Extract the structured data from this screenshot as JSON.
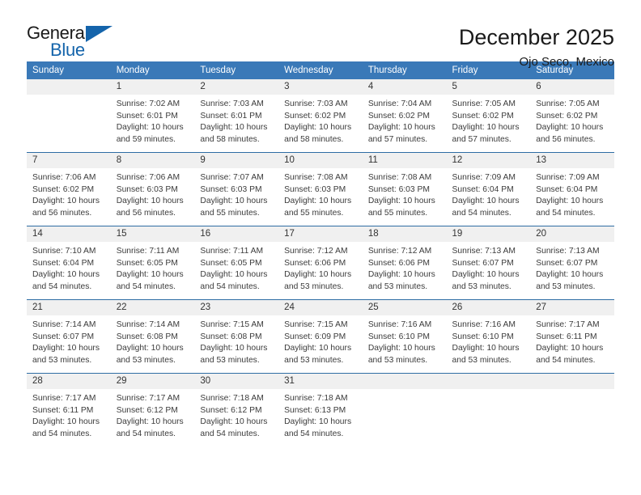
{
  "brand": {
    "line1": "General",
    "line2": "Blue",
    "triangle_color": "#1464ab"
  },
  "header": {
    "title": "December 2025",
    "subtitle": "Ojo Seco, Mexico",
    "header_bg": "#3a79b8",
    "daynum_bg": "#f0f0f0"
  },
  "weekdays": [
    "Sunday",
    "Monday",
    "Tuesday",
    "Wednesday",
    "Thursday",
    "Friday",
    "Saturday"
  ],
  "weeks": [
    [
      {
        "day": "",
        "sunrise": "",
        "sunset": "",
        "daylight_line1": "",
        "daylight_line2": ""
      },
      {
        "day": "1",
        "sunrise": "Sunrise: 7:02 AM",
        "sunset": "Sunset: 6:01 PM",
        "daylight_line1": "Daylight: 10 hours",
        "daylight_line2": "and 59 minutes."
      },
      {
        "day": "2",
        "sunrise": "Sunrise: 7:03 AM",
        "sunset": "Sunset: 6:01 PM",
        "daylight_line1": "Daylight: 10 hours",
        "daylight_line2": "and 58 minutes."
      },
      {
        "day": "3",
        "sunrise": "Sunrise: 7:03 AM",
        "sunset": "Sunset: 6:02 PM",
        "daylight_line1": "Daylight: 10 hours",
        "daylight_line2": "and 58 minutes."
      },
      {
        "day": "4",
        "sunrise": "Sunrise: 7:04 AM",
        "sunset": "Sunset: 6:02 PM",
        "daylight_line1": "Daylight: 10 hours",
        "daylight_line2": "and 57 minutes."
      },
      {
        "day": "5",
        "sunrise": "Sunrise: 7:05 AM",
        "sunset": "Sunset: 6:02 PM",
        "daylight_line1": "Daylight: 10 hours",
        "daylight_line2": "and 57 minutes."
      },
      {
        "day": "6",
        "sunrise": "Sunrise: 7:05 AM",
        "sunset": "Sunset: 6:02 PM",
        "daylight_line1": "Daylight: 10 hours",
        "daylight_line2": "and 56 minutes."
      }
    ],
    [
      {
        "day": "7",
        "sunrise": "Sunrise: 7:06 AM",
        "sunset": "Sunset: 6:02 PM",
        "daylight_line1": "Daylight: 10 hours",
        "daylight_line2": "and 56 minutes."
      },
      {
        "day": "8",
        "sunrise": "Sunrise: 7:06 AM",
        "sunset": "Sunset: 6:03 PM",
        "daylight_line1": "Daylight: 10 hours",
        "daylight_line2": "and 56 minutes."
      },
      {
        "day": "9",
        "sunrise": "Sunrise: 7:07 AM",
        "sunset": "Sunset: 6:03 PM",
        "daylight_line1": "Daylight: 10 hours",
        "daylight_line2": "and 55 minutes."
      },
      {
        "day": "10",
        "sunrise": "Sunrise: 7:08 AM",
        "sunset": "Sunset: 6:03 PM",
        "daylight_line1": "Daylight: 10 hours",
        "daylight_line2": "and 55 minutes."
      },
      {
        "day": "11",
        "sunrise": "Sunrise: 7:08 AM",
        "sunset": "Sunset: 6:03 PM",
        "daylight_line1": "Daylight: 10 hours",
        "daylight_line2": "and 55 minutes."
      },
      {
        "day": "12",
        "sunrise": "Sunrise: 7:09 AM",
        "sunset": "Sunset: 6:04 PM",
        "daylight_line1": "Daylight: 10 hours",
        "daylight_line2": "and 54 minutes."
      },
      {
        "day": "13",
        "sunrise": "Sunrise: 7:09 AM",
        "sunset": "Sunset: 6:04 PM",
        "daylight_line1": "Daylight: 10 hours",
        "daylight_line2": "and 54 minutes."
      }
    ],
    [
      {
        "day": "14",
        "sunrise": "Sunrise: 7:10 AM",
        "sunset": "Sunset: 6:04 PM",
        "daylight_line1": "Daylight: 10 hours",
        "daylight_line2": "and 54 minutes."
      },
      {
        "day": "15",
        "sunrise": "Sunrise: 7:11 AM",
        "sunset": "Sunset: 6:05 PM",
        "daylight_line1": "Daylight: 10 hours",
        "daylight_line2": "and 54 minutes."
      },
      {
        "day": "16",
        "sunrise": "Sunrise: 7:11 AM",
        "sunset": "Sunset: 6:05 PM",
        "daylight_line1": "Daylight: 10 hours",
        "daylight_line2": "and 54 minutes."
      },
      {
        "day": "17",
        "sunrise": "Sunrise: 7:12 AM",
        "sunset": "Sunset: 6:06 PM",
        "daylight_line1": "Daylight: 10 hours",
        "daylight_line2": "and 53 minutes."
      },
      {
        "day": "18",
        "sunrise": "Sunrise: 7:12 AM",
        "sunset": "Sunset: 6:06 PM",
        "daylight_line1": "Daylight: 10 hours",
        "daylight_line2": "and 53 minutes."
      },
      {
        "day": "19",
        "sunrise": "Sunrise: 7:13 AM",
        "sunset": "Sunset: 6:07 PM",
        "daylight_line1": "Daylight: 10 hours",
        "daylight_line2": "and 53 minutes."
      },
      {
        "day": "20",
        "sunrise": "Sunrise: 7:13 AM",
        "sunset": "Sunset: 6:07 PM",
        "daylight_line1": "Daylight: 10 hours",
        "daylight_line2": "and 53 minutes."
      }
    ],
    [
      {
        "day": "21",
        "sunrise": "Sunrise: 7:14 AM",
        "sunset": "Sunset: 6:07 PM",
        "daylight_line1": "Daylight: 10 hours",
        "daylight_line2": "and 53 minutes."
      },
      {
        "day": "22",
        "sunrise": "Sunrise: 7:14 AM",
        "sunset": "Sunset: 6:08 PM",
        "daylight_line1": "Daylight: 10 hours",
        "daylight_line2": "and 53 minutes."
      },
      {
        "day": "23",
        "sunrise": "Sunrise: 7:15 AM",
        "sunset": "Sunset: 6:08 PM",
        "daylight_line1": "Daylight: 10 hours",
        "daylight_line2": "and 53 minutes."
      },
      {
        "day": "24",
        "sunrise": "Sunrise: 7:15 AM",
        "sunset": "Sunset: 6:09 PM",
        "daylight_line1": "Daylight: 10 hours",
        "daylight_line2": "and 53 minutes."
      },
      {
        "day": "25",
        "sunrise": "Sunrise: 7:16 AM",
        "sunset": "Sunset: 6:10 PM",
        "daylight_line1": "Daylight: 10 hours",
        "daylight_line2": "and 53 minutes."
      },
      {
        "day": "26",
        "sunrise": "Sunrise: 7:16 AM",
        "sunset": "Sunset: 6:10 PM",
        "daylight_line1": "Daylight: 10 hours",
        "daylight_line2": "and 53 minutes."
      },
      {
        "day": "27",
        "sunrise": "Sunrise: 7:17 AM",
        "sunset": "Sunset: 6:11 PM",
        "daylight_line1": "Daylight: 10 hours",
        "daylight_line2": "and 54 minutes."
      }
    ],
    [
      {
        "day": "28",
        "sunrise": "Sunrise: 7:17 AM",
        "sunset": "Sunset: 6:11 PM",
        "daylight_line1": "Daylight: 10 hours",
        "daylight_line2": "and 54 minutes."
      },
      {
        "day": "29",
        "sunrise": "Sunrise: 7:17 AM",
        "sunset": "Sunset: 6:12 PM",
        "daylight_line1": "Daylight: 10 hours",
        "daylight_line2": "and 54 minutes."
      },
      {
        "day": "30",
        "sunrise": "Sunrise: 7:18 AM",
        "sunset": "Sunset: 6:12 PM",
        "daylight_line1": "Daylight: 10 hours",
        "daylight_line2": "and 54 minutes."
      },
      {
        "day": "31",
        "sunrise": "Sunrise: 7:18 AM",
        "sunset": "Sunset: 6:13 PM",
        "daylight_line1": "Daylight: 10 hours",
        "daylight_line2": "and 54 minutes."
      },
      {
        "day": "",
        "sunrise": "",
        "sunset": "",
        "daylight_line1": "",
        "daylight_line2": ""
      },
      {
        "day": "",
        "sunrise": "",
        "sunset": "",
        "daylight_line1": "",
        "daylight_line2": ""
      },
      {
        "day": "",
        "sunrise": "",
        "sunset": "",
        "daylight_line1": "",
        "daylight_line2": ""
      }
    ]
  ]
}
